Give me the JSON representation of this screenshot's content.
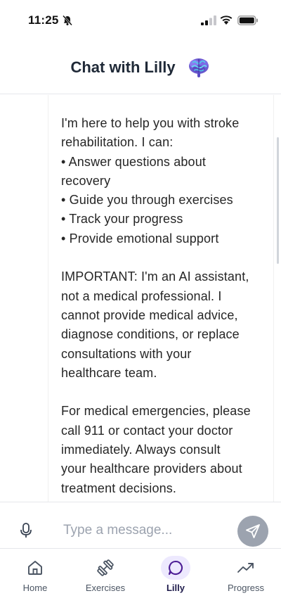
{
  "status_bar": {
    "time": "11:25"
  },
  "header": {
    "title": "Chat with Lilly"
  },
  "chat": {
    "message": "I'm here to help you with stroke\nrehabilitation. I can:\n• Answer questions about\nrecovery\n• Guide you through exercises\n• Track your progress\n• Provide emotional support\n\nIMPORTANT: I'm an AI assistant,\nnot a medical professional. I\ncannot provide medical advice,\ndiagnose conditions, or replace\nconsultations with your\nhealthcare team.\n\nFor medical emergencies, please\ncall 911 or contact your doctor\nimmediately. Always consult\nyour healthcare providers about\ntreatment decisions."
  },
  "input": {
    "placeholder": "Type a message..."
  },
  "nav": {
    "items": [
      {
        "label": "Home",
        "icon": "home-icon"
      },
      {
        "label": "Exercises",
        "icon": "dumbbell-icon"
      },
      {
        "label": "Lilly",
        "icon": "chat-bubble-icon"
      },
      {
        "label": "Progress",
        "icon": "trending-up-icon"
      }
    ],
    "active": "Lilly"
  },
  "colors": {
    "send_button": "#9ca3af",
    "active_nav_bg": "#ede9fe",
    "active_nav_icon": "#4c1d95"
  }
}
